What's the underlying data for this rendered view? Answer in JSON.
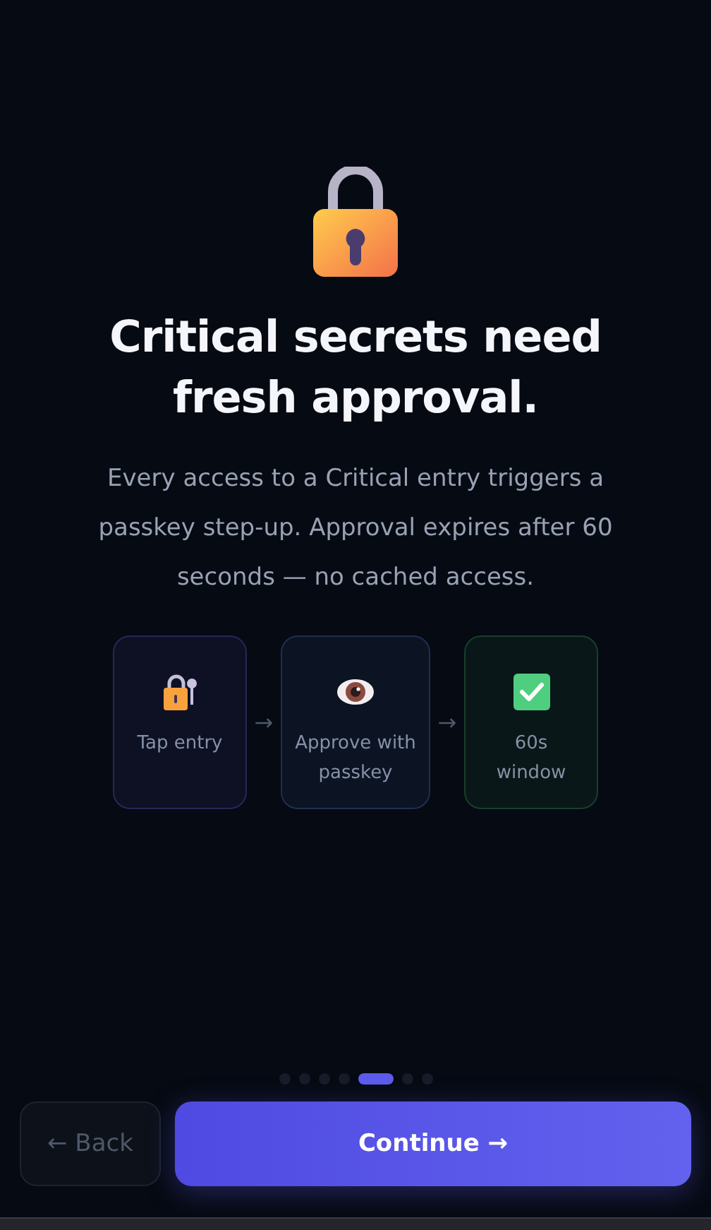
{
  "title": "Critical secrets need fresh approval.",
  "description": "Every access to a Critical entry triggers a passkey step-up. Approval expires after 60 seconds — no cached access.",
  "steps": [
    {
      "kind": "lock-key",
      "label": "Tap entry",
      "color": "#27275a"
    },
    {
      "kind": "eye",
      "label": "Approve with passkey",
      "color": "#1e2f52"
    },
    {
      "kind": "check",
      "label": "60s window",
      "color": "#17402a"
    }
  ],
  "arrow": "→",
  "pager": [
    {
      "selected": false
    },
    {
      "selected": false
    },
    {
      "selected": false
    },
    {
      "selected": false
    },
    {
      "selected": true
    },
    {
      "selected": false
    },
    {
      "selected": false
    }
  ],
  "buttons": {
    "back": "← Back",
    "continue": "Continue →"
  }
}
